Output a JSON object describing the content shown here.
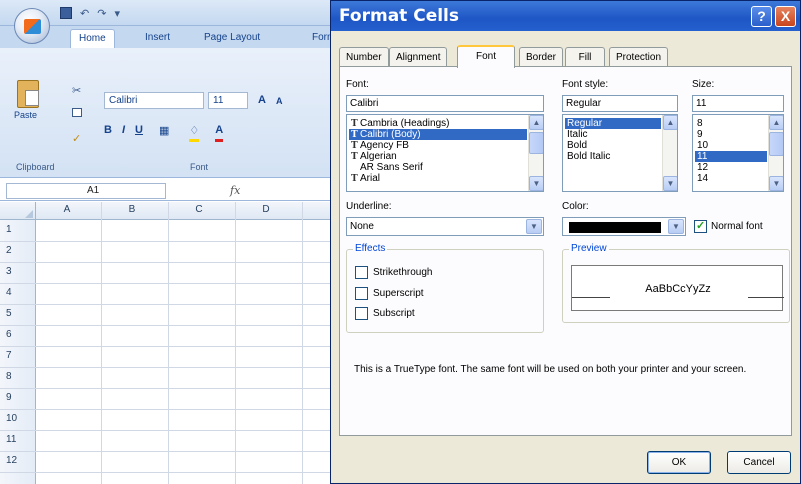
{
  "excel": {
    "ribbon_tabs": [
      "Home",
      "Insert",
      "Page Layout",
      "Form"
    ],
    "ribbon": {
      "paste_label": "Paste",
      "font_name": "Calibri",
      "font_size": "11",
      "grow_font": "A",
      "shrink_font": "A",
      "bold": "B",
      "italic": "I",
      "underline": "U",
      "font_color": "A",
      "clipboard_label": "Clipboard",
      "font_group_label": "Font"
    },
    "name_box": "A1",
    "fx": "fx",
    "columns": [
      "A",
      "B",
      "C",
      "D"
    ],
    "rows": [
      "1",
      "2",
      "3",
      "4",
      "5",
      "6",
      "7",
      "8",
      "9",
      "10",
      "11",
      "12"
    ]
  },
  "dialog": {
    "title": "Format Cells",
    "help": "?",
    "close": "X",
    "tabs": [
      "Number",
      "Alignment",
      "Font",
      "Border",
      "Fill",
      "Protection"
    ],
    "active_tab": "Font",
    "font_label": "Font:",
    "font_value": "Calibri",
    "font_list": [
      "Cambria (Headings)",
      "Calibri (Body)",
      "Agency FB",
      "Algerian",
      "AR Sans Serif",
      "Arial"
    ],
    "font_selected": "Calibri (Body)",
    "style_label": "Font style:",
    "style_value": "Regular",
    "style_list": [
      "Regular",
      "Italic",
      "Bold",
      "Bold Italic"
    ],
    "style_selected": "Regular",
    "size_label": "Size:",
    "size_value": "11",
    "size_list": [
      "8",
      "9",
      "10",
      "11",
      "12",
      "14"
    ],
    "size_selected": "11",
    "underline_label": "Underline:",
    "underline_value": "None",
    "color_label": "Color:",
    "color_value": "#000000",
    "normal_font_label": "Normal font",
    "normal_font_checked": true,
    "effects_label": "Effects",
    "effects": [
      "Strikethrough",
      "Superscript",
      "Subscript"
    ],
    "preview_label": "Preview",
    "preview_text": "AaBbCcYyZz",
    "info_text": "This is a TrueType font.  The same font will be used on both your printer and your screen.",
    "ok_label": "OK",
    "cancel_label": "Cancel"
  },
  "colors": {
    "title_bar": "#1e56c5",
    "selection": "#316ac5",
    "dialog_bg": "#ece9d8"
  }
}
